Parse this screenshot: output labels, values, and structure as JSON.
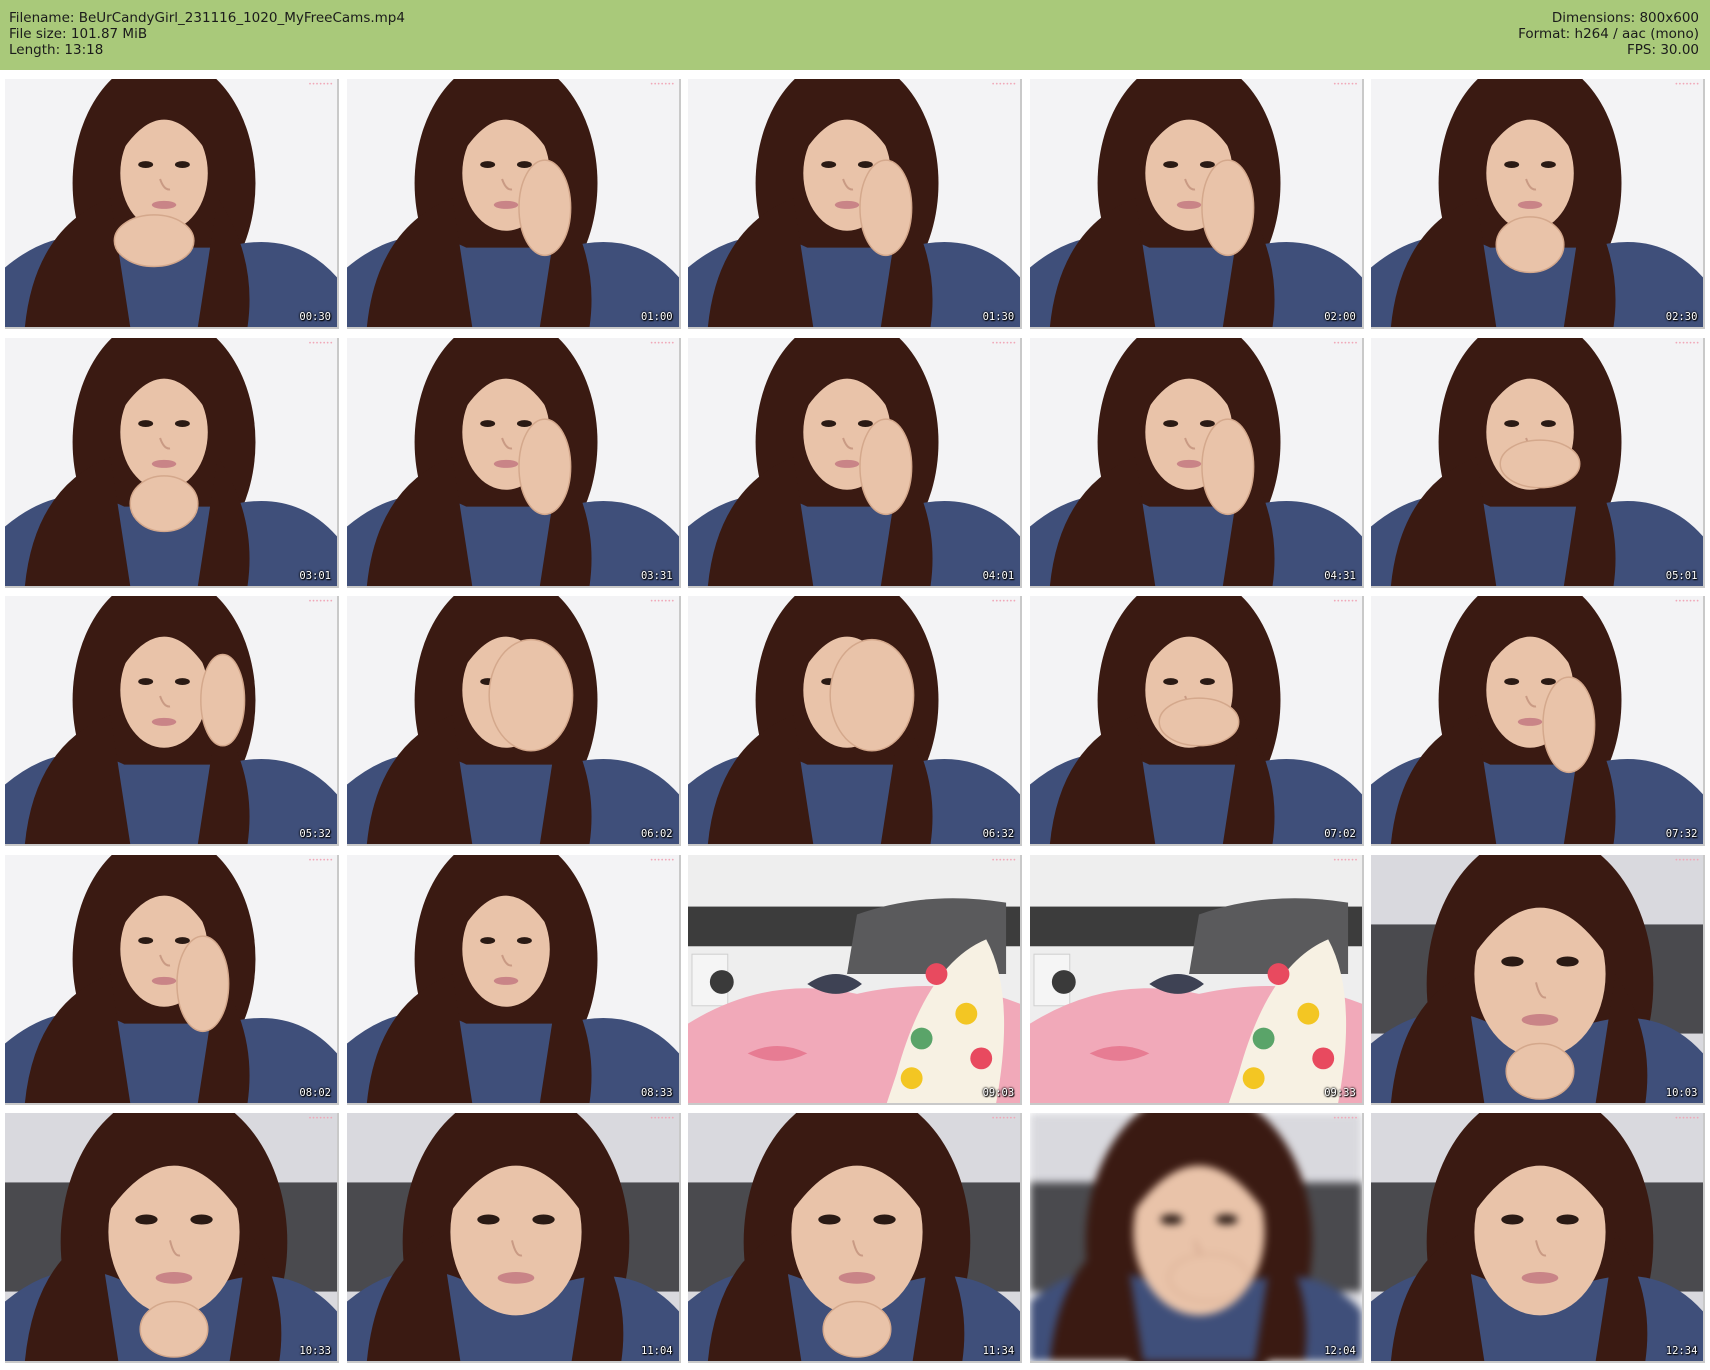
{
  "header": {
    "filename_label": "Filename:",
    "filename": "BeUrCandyGirl_231116_1020_MyFreeCams.mp4",
    "filesize_label": "File size:",
    "filesize": "101.87 MiB",
    "length_label": "Length:",
    "length": "13:18",
    "dimensions_label": "Dimensions:",
    "dimensions": "800x600",
    "format_label": "Format:",
    "format": "h264 / aac (mono)",
    "fps_label": "FPS:",
    "fps": "30.00"
  },
  "colors": {
    "header_bg": "#a9c97a",
    "hair": "#3a1a12",
    "skin": "#e9c3a9",
    "sweater": "#3f4f7a",
    "bed_pink": "#f1a9b9",
    "headboard": "#3c3c3c"
  },
  "thumbnails": [
    {
      "time": "00:30",
      "scene": "face",
      "pose": "hand-chin"
    },
    {
      "time": "01:00",
      "scene": "face",
      "pose": "hand-cheek"
    },
    {
      "time": "01:30",
      "scene": "face",
      "pose": "hand-cheek"
    },
    {
      "time": "02:00",
      "scene": "face",
      "pose": "hand-cheek"
    },
    {
      "time": "02:30",
      "scene": "face",
      "pose": "fist-chin"
    },
    {
      "time": "03:01",
      "scene": "face",
      "pose": "fist-chin"
    },
    {
      "time": "03:31",
      "scene": "face",
      "pose": "hand-cheek"
    },
    {
      "time": "04:01",
      "scene": "face",
      "pose": "hand-cheek"
    },
    {
      "time": "04:31",
      "scene": "face",
      "pose": "hand-cheek"
    },
    {
      "time": "05:01",
      "scene": "face",
      "pose": "hand-mouth"
    },
    {
      "time": "05:32",
      "scene": "face",
      "pose": "hand-ear"
    },
    {
      "time": "06:02",
      "scene": "face",
      "pose": "hand-face"
    },
    {
      "time": "06:32",
      "scene": "face",
      "pose": "hand-face"
    },
    {
      "time": "07:02",
      "scene": "face",
      "pose": "hand-mouth"
    },
    {
      "time": "07:32",
      "scene": "face",
      "pose": "hand-cheek"
    },
    {
      "time": "08:02",
      "scene": "face",
      "pose": "hand-cheek"
    },
    {
      "time": "08:33",
      "scene": "face",
      "pose": "none"
    },
    {
      "time": "09:03",
      "scene": "bed",
      "pose": "none"
    },
    {
      "time": "09:33",
      "scene": "bed",
      "pose": "none"
    },
    {
      "time": "10:03",
      "scene": "closeup",
      "pose": "fist-chin"
    },
    {
      "time": "10:33",
      "scene": "closeup",
      "pose": "fist-chin"
    },
    {
      "time": "11:04",
      "scene": "closeup",
      "pose": "none"
    },
    {
      "time": "11:34",
      "scene": "closeup",
      "pose": "fist-chin"
    },
    {
      "time": "12:04",
      "scene": "blur",
      "pose": "hand-mouth"
    },
    {
      "time": "12:34",
      "scene": "closeup",
      "pose": "none"
    }
  ]
}
